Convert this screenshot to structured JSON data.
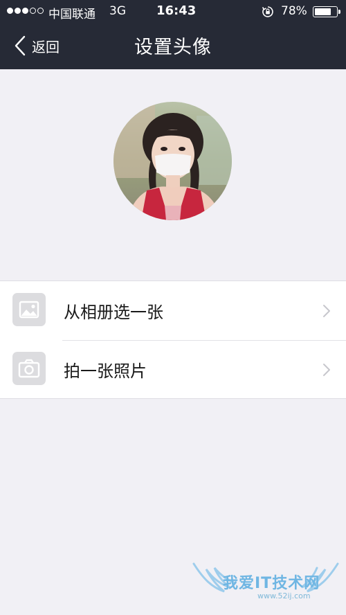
{
  "status_bar": {
    "carrier": "中国联通",
    "network": "3G",
    "time": "16:43",
    "battery_percent": "78%",
    "battery_level": 0.78
  },
  "nav": {
    "back_label": "返回",
    "title": "设置头像"
  },
  "avatar": {
    "alt": "current profile avatar"
  },
  "menu": {
    "items": [
      {
        "label": "从相册选一张",
        "icon": "image-icon"
      },
      {
        "label": "拍一张照片",
        "icon": "camera-icon"
      }
    ]
  },
  "watermark": {
    "text": "我爱IT技术网",
    "url": "www.52ij.com"
  },
  "colors": {
    "nav_background": "#262a36",
    "page_background": "#f1f0f5",
    "icon_background": "#dcdcdf",
    "chevron": "#c7c7cc"
  }
}
